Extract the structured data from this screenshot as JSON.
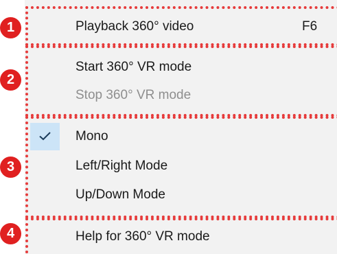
{
  "menu": {
    "groups": [
      {
        "number": "1",
        "items": [
          {
            "label": "Playback 360° video",
            "shortcut": "F6"
          }
        ]
      },
      {
        "number": "2",
        "items": [
          {
            "label": "Start 360° VR mode"
          },
          {
            "label": "Stop 360° VR mode",
            "disabled": true
          }
        ]
      },
      {
        "number": "3",
        "items": [
          {
            "label": "Mono",
            "checked": true
          },
          {
            "label": "Left/Right Mode"
          },
          {
            "label": "Up/Down Mode"
          }
        ]
      },
      {
        "number": "4",
        "items": [
          {
            "label": "Help for 360° VR mode"
          }
        ]
      }
    ]
  },
  "colors": {
    "menu_background": "#f2f2f2",
    "check_highlight": "#cce4f7",
    "check_mark": "#1a3a5a",
    "annotation": "#e63b3b",
    "badge": "#e02020",
    "disabled_text": "#8e8e8e"
  },
  "icons": {
    "checked_item": "check-icon"
  }
}
